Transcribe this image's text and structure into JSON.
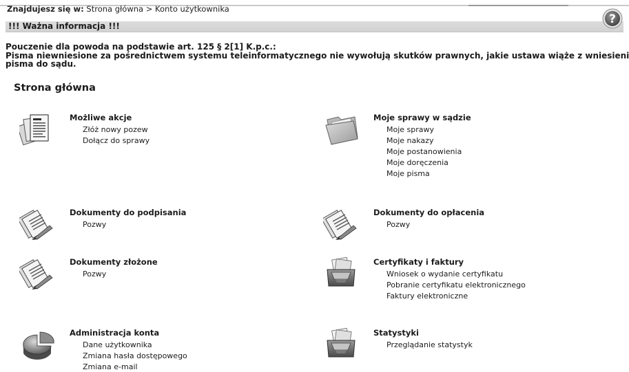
{
  "breadcrumb": {
    "label": "Znajdujesz się w:",
    "items": [
      "Strona główna",
      "Konto użytkownika"
    ],
    "separator": ">"
  },
  "info_bar": {
    "title": "!!! Ważna informacja !!!"
  },
  "help_button": {
    "label": "?"
  },
  "notice": {
    "lines": [
      "Pouczenie dla powoda na podstawie art. 125 § 2[1] K.p.c.:",
      "Pisma niewniesione za pośrednictwem systemu teleinformatycznego nie wywołują skutków prawnych, jakie ustawa wiąże z wniesieniem",
      "pisma do sądu."
    ]
  },
  "page_title": "Strona główna",
  "sections": [
    {
      "title": "Możliwe akcje",
      "icon": "document-list-icon",
      "links": [
        "Złóż nowy pozew",
        "Dołącz do sprawy"
      ]
    },
    {
      "title": "Moje sprawy w sądzie",
      "icon": "folder-icon",
      "links": [
        "Moje sprawy",
        "Moje nakazy",
        "Moje postanowienia",
        "Moje doręczenia",
        "Moje pisma"
      ]
    },
    {
      "title": "Dokumenty do podpisania",
      "icon": "sign-documents-icon",
      "links": [
        "Pozwy"
      ]
    },
    {
      "title": "Dokumenty do opłacenia",
      "icon": "sign-documents-icon",
      "links": [
        "Pozwy"
      ]
    },
    {
      "title": "Dokumenty złożone",
      "icon": "sign-documents-icon",
      "links": [
        "Pozwy"
      ]
    },
    {
      "title": "Certyfikaty i faktury",
      "icon": "inbox-tray-icon",
      "links": [
        "Wniosek o wydanie certyfikatu",
        "Pobranie certyfikatu elektronicznego",
        "Faktury elektroniczne"
      ]
    },
    {
      "title": "Administracja konta",
      "icon": "pie-chart-icon",
      "links": [
        "Dane użytkownika",
        "Zmiana hasła dostępowego",
        "Zmiana e-mail"
      ]
    },
    {
      "title": "Statystyki",
      "icon": "inbox-tray-icon",
      "links": [
        "Przeglądanie statystyk"
      ]
    }
  ]
}
